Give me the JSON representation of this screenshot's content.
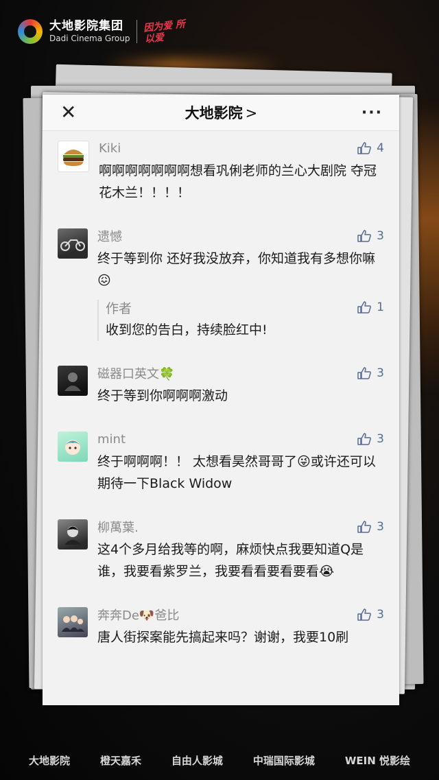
{
  "brand": {
    "name_cn": "大地影院集团",
    "name_en": "Dadi Cinema Group",
    "slogan": "因为爱 所以爱"
  },
  "nav": {
    "close": "✕",
    "title": "大地影院",
    "chevron": ">",
    "more": "···"
  },
  "comments": [
    {
      "name": "Kiki",
      "likes": "4",
      "avatar": "burger",
      "text": "啊啊啊啊啊啊啊想看巩俐老师的兰心大剧院 夺冠 花木兰！！！！"
    },
    {
      "name": "遗憾",
      "likes": "3",
      "avatar": "motorcycle",
      "text": "终于等到你  还好我没放弃，你知道我有多想你嘛😖",
      "reply": {
        "name": "作者",
        "likes": "1",
        "text": "收到您的告白，持续脸红中!"
      }
    },
    {
      "name": "磁器口英文🍀",
      "likes": "3",
      "avatar": "person-dark",
      "text": "终于等到你啊啊啊激动"
    },
    {
      "name": "mint",
      "likes": "3",
      "avatar": "anime-face",
      "text": "终于啊啊啊！！ 太想看昊然哥哥了😜或许还可以期待一下Black Widow"
    },
    {
      "name": "柳萬葉.",
      "likes": "3",
      "avatar": "person-bw",
      "text": "这4个多月给我等的啊，麻烦快点我要知道Q是谁，我要看紫罗兰，我要看看要看要看😭"
    },
    {
      "name": "奔奔De🐶爸比",
      "likes": "3",
      "avatar": "group-photo",
      "text": "唐人街探案能先搞起来吗？谢谢，我要10刷"
    }
  ],
  "sponsors": [
    "大地影院",
    "橙天嘉禾",
    "自由人影城",
    "中瑞国际影城",
    "WEIN 悦影绘"
  ]
}
